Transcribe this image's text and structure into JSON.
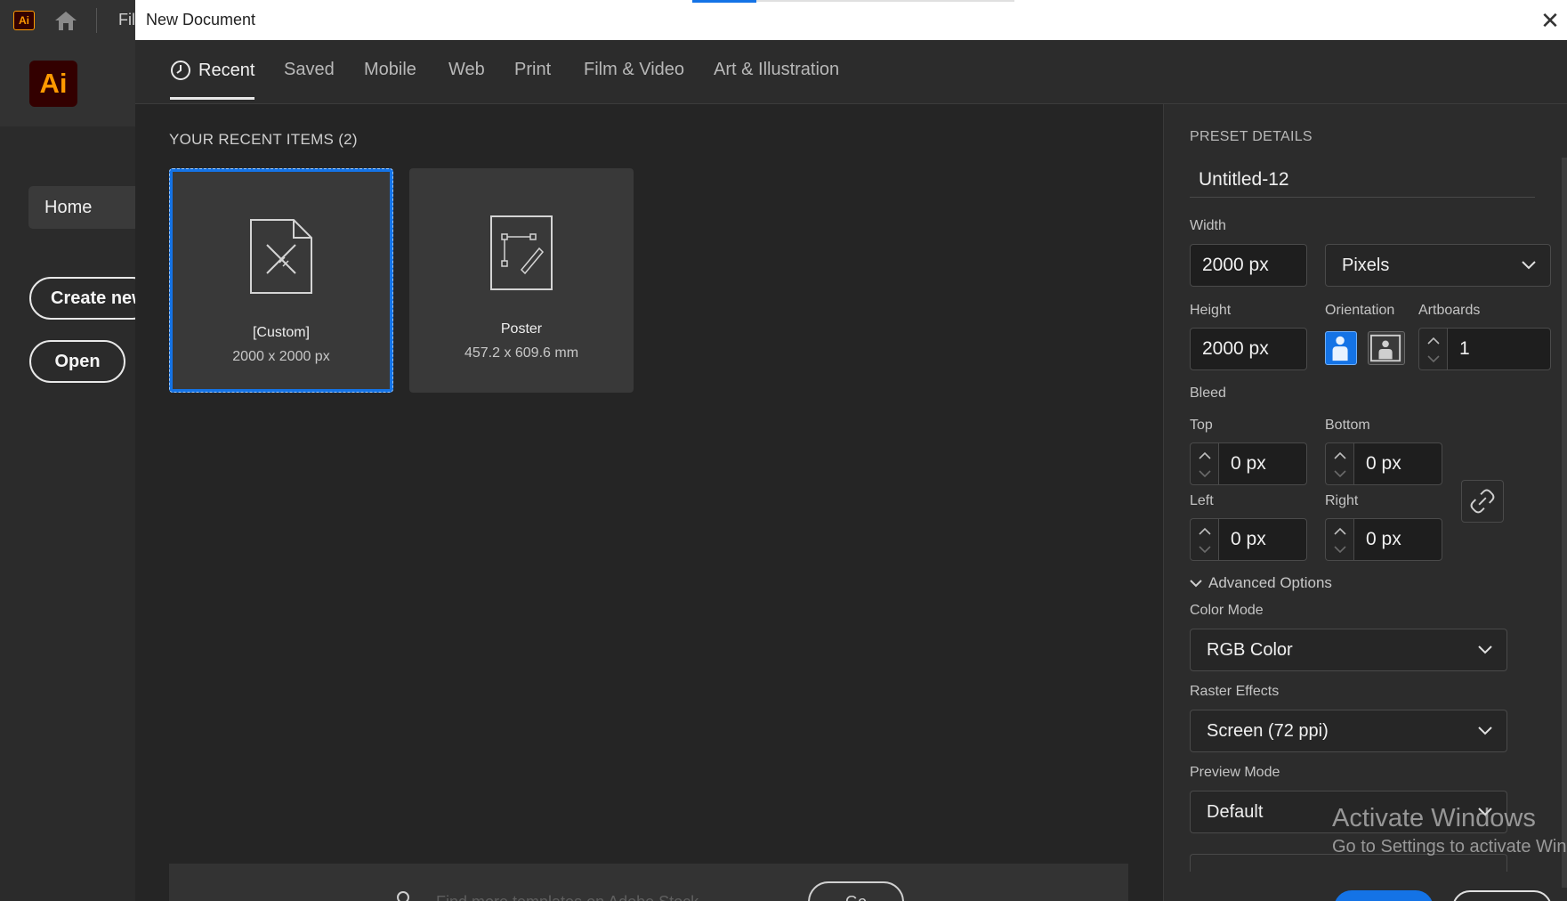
{
  "app": {
    "logo_small": "Ai",
    "logo_big": "Ai",
    "menu_file": "Fil",
    "home_label": "Home",
    "create_new_label": "Create new",
    "open_label": "Open"
  },
  "dialog": {
    "title": "New Document",
    "close_glyph": "✕",
    "tabs": [
      {
        "label": "Recent",
        "active": true
      },
      {
        "label": "Saved"
      },
      {
        "label": "Mobile"
      },
      {
        "label": "Web"
      },
      {
        "label": "Print"
      },
      {
        "label": "Film & Video"
      },
      {
        "label": "Art & Illustration"
      }
    ]
  },
  "recent": {
    "header": "YOUR RECENT ITEMS  (2)",
    "items": [
      {
        "name": "[Custom]",
        "size": "2000 x 2000 px",
        "selected": true
      },
      {
        "name": "Poster",
        "size": "457.2 x 609.6 mm",
        "selected": false
      }
    ]
  },
  "stock_search": {
    "placeholder": "Find more templates on Adobe Stock",
    "go_label": "Go"
  },
  "preset": {
    "header": "PRESET DETAILS",
    "name": "Untitled-12",
    "width_label": "Width",
    "width_value": "2000 px",
    "units": "Pixels",
    "height_label": "Height",
    "height_value": "2000 px",
    "orientation_label": "Orientation",
    "artboards_label": "Artboards",
    "artboards_value": "1",
    "bleed_label": "Bleed",
    "top_label": "Top",
    "top_value": "0 px",
    "bottom_label": "Bottom",
    "bottom_value": "0 px",
    "left_label": "Left",
    "left_value": "0 px",
    "right_label": "Right",
    "right_value": "0 px",
    "advanced_label": "Advanced Options",
    "color_mode_label": "Color Mode",
    "color_mode_value": "RGB Color",
    "raster_label": "Raster Effects",
    "raster_value": "Screen (72 ppi)",
    "preview_label": "Preview Mode",
    "preview_value": "Default"
  },
  "watermark": {
    "title": "Activate Windows",
    "subtitle": "Go to Settings to activate Windows."
  },
  "colors": {
    "accent": "#1473e6",
    "brand_orange": "#ff9a00",
    "brand_dark": "#330000"
  }
}
